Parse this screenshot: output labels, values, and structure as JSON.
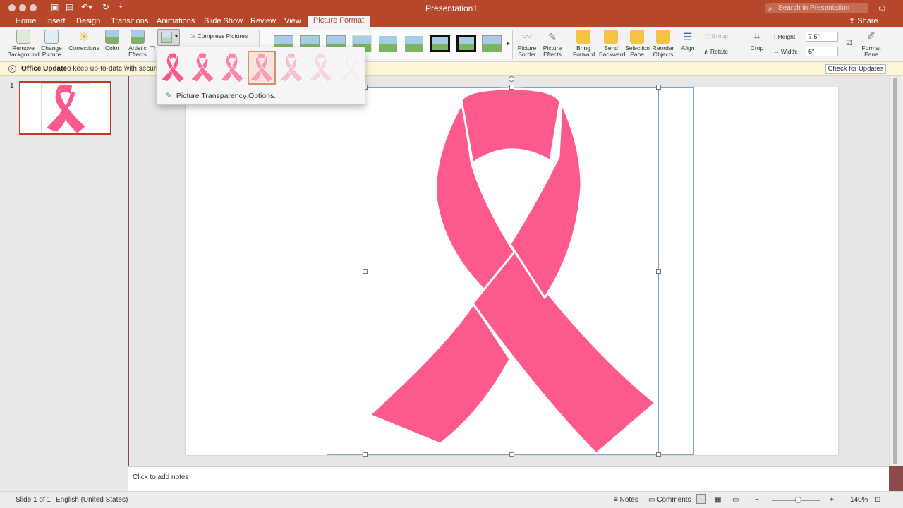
{
  "window": {
    "title": "Presentation1",
    "search_placeholder": "Search in Presentation",
    "share_label": "Share"
  },
  "tabs": [
    "Home",
    "Insert",
    "Design",
    "Transitions",
    "Animations",
    "Slide Show",
    "Review",
    "View",
    "Picture Format"
  ],
  "active_tab": "Picture Format",
  "ribbon": {
    "remove_background": "Remove\nBackground",
    "change_picture": "Change\nPicture",
    "corrections": "Corrections",
    "color": "Color",
    "artistic_effects": "Artistic\nEffects",
    "transparency_partial": "Tr",
    "compress_pictures": "Compress Pictures",
    "picture_border": "Picture\nBorder",
    "picture_effects": "Picture\nEffects",
    "bring_forward": "Bring\nForward",
    "send_backward": "Send\nBackward",
    "selection_pane": "Selection\nPane",
    "reorder_objects": "Reorder\nObjects",
    "align": "Align",
    "group": "Group",
    "rotate": "Rotate",
    "crop": "Crop",
    "height_label": "Height:",
    "height_value": "7.5\"",
    "width_label": "Width:",
    "width_value": "6\"",
    "format_pane": "Format\nPane"
  },
  "infobar": {
    "title": "Office Update",
    "message": "To keep up-to-date with security up",
    "button": "Check for Updates"
  },
  "slides_panel": {
    "slide_number": "1"
  },
  "transparency_menu": {
    "presets": [
      0,
      15,
      30,
      50,
      65,
      80,
      95
    ],
    "selected_index": 3,
    "options_label": "Picture Transparency Options..."
  },
  "notes_placeholder": "Click to add notes",
  "statusbar": {
    "slide_info": "Slide 1 of 1",
    "language": "English (United States)",
    "notes": "Notes",
    "comments": "Comments",
    "zoom": "140%"
  },
  "colors": {
    "accent": "#b7472a",
    "ribbon_pink": "#fc5a8d"
  }
}
